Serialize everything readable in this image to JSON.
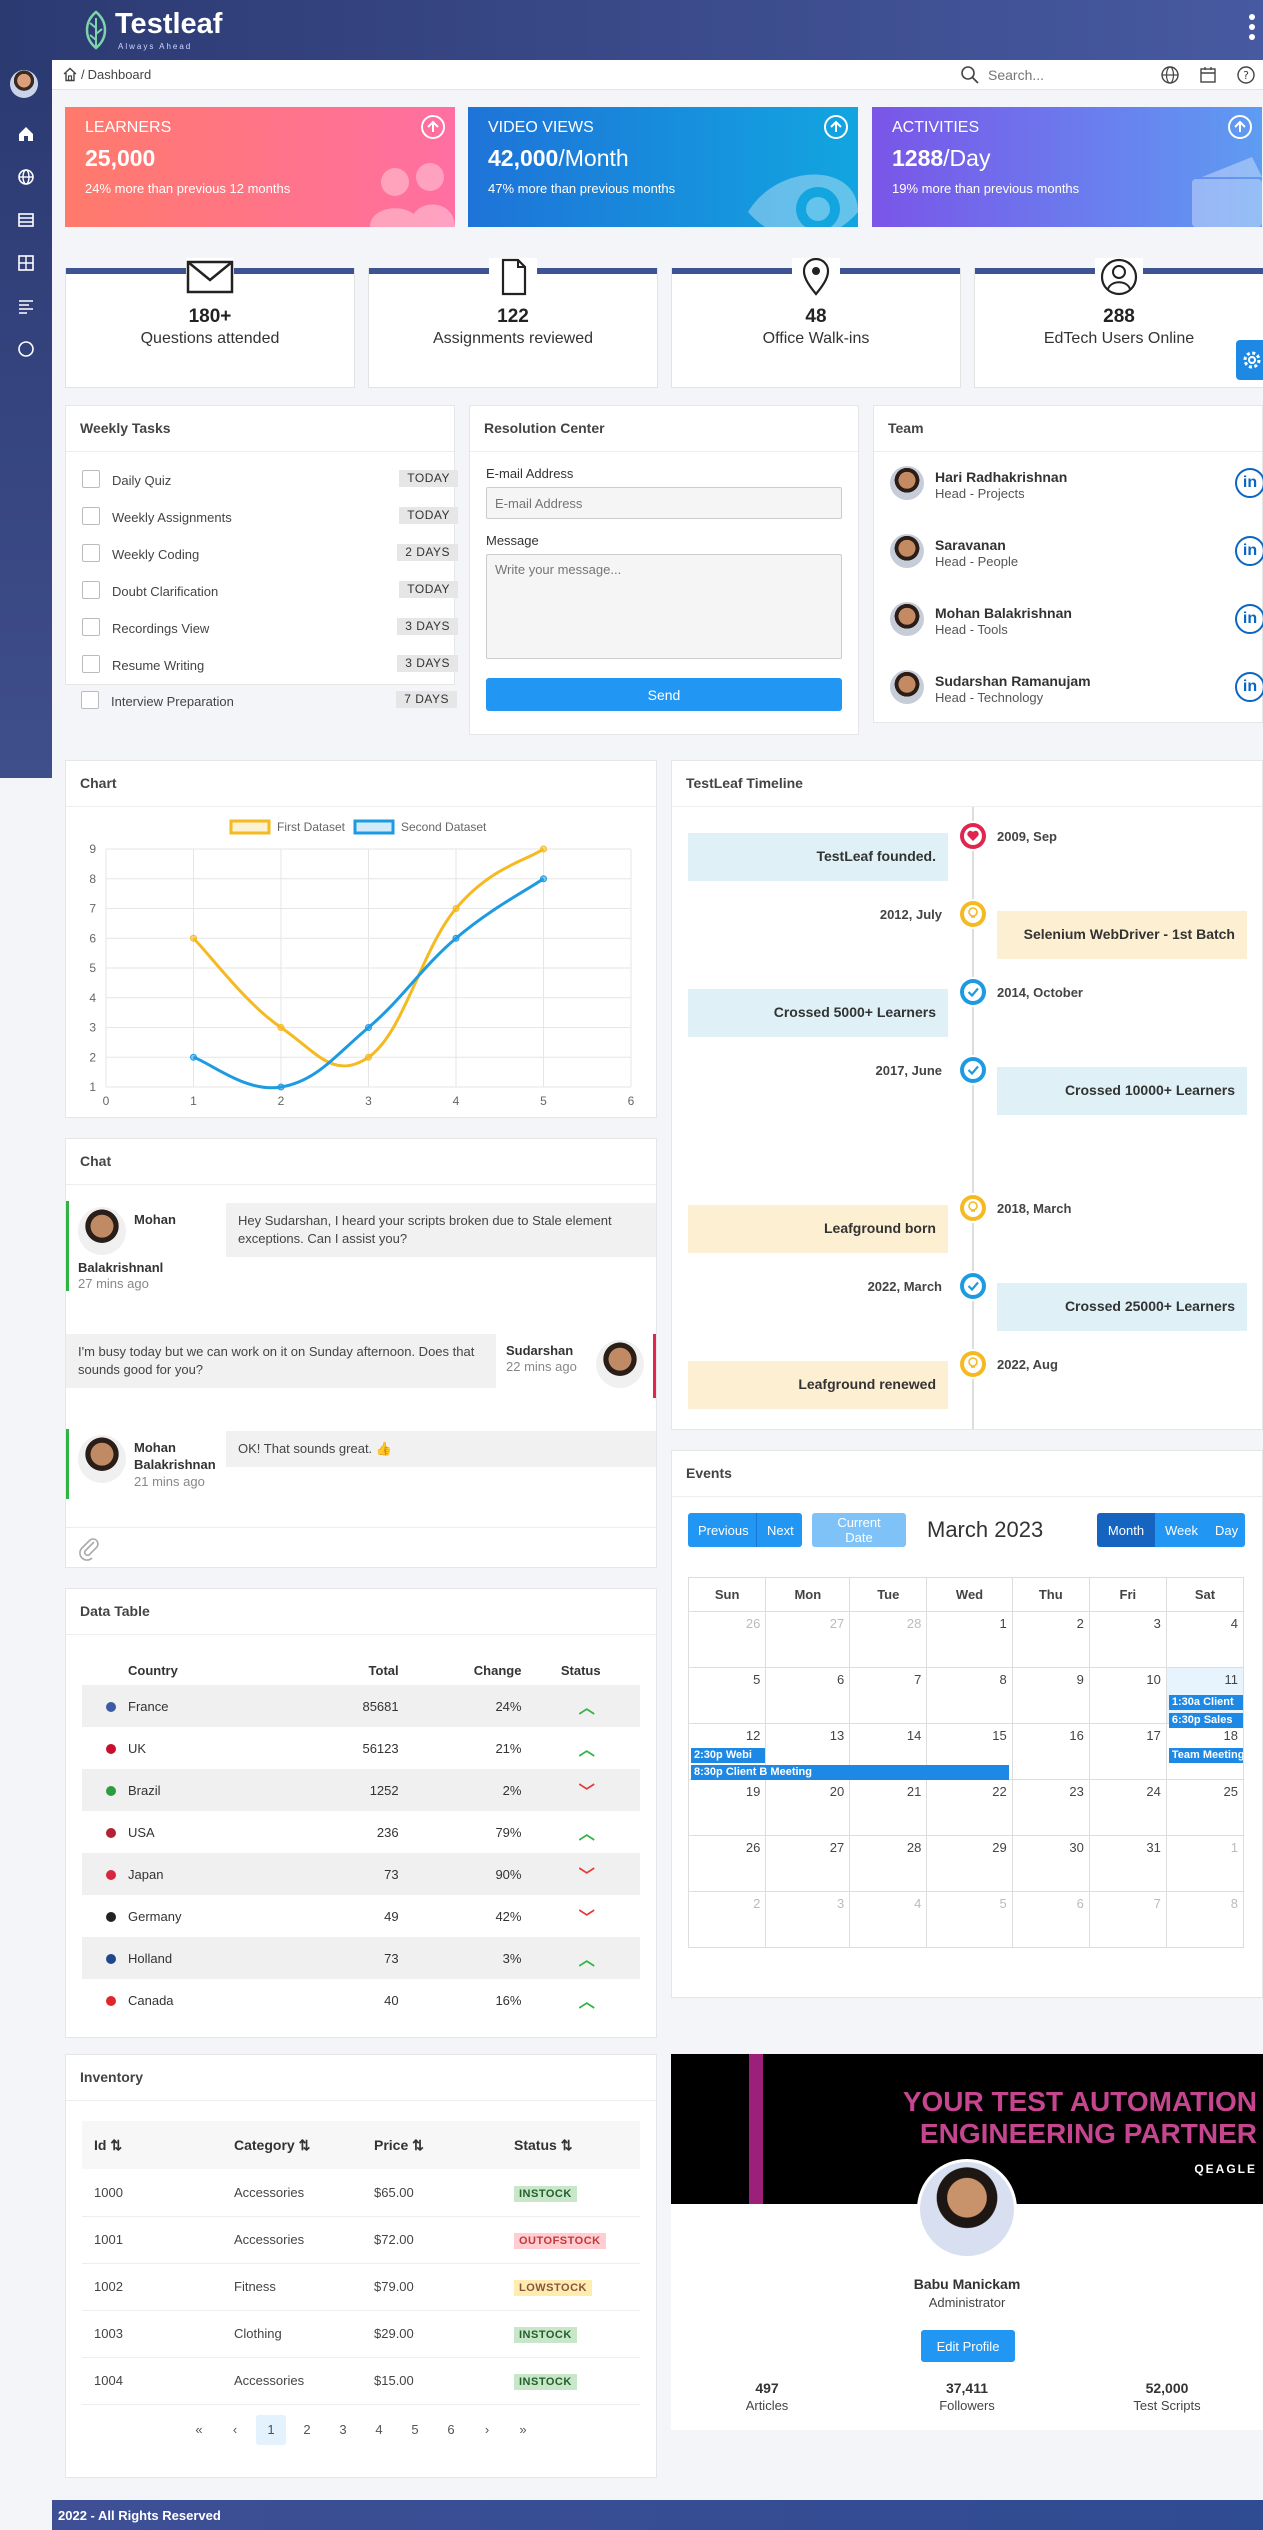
{
  "brand": {
    "name": "Testleaf",
    "tagline": "Always Ahead"
  },
  "breadcrumb": {
    "separator": "/",
    "current": "Dashboard"
  },
  "search": {
    "placeholder": "Search..."
  },
  "kpis": [
    {
      "label": "LEARNERS",
      "value": "25,000",
      "unit": "",
      "sub": "24% more than previous 12 months",
      "color_from": "#ff7a6b",
      "color_to": "#ff6fa2"
    },
    {
      "label": "VIDEO VIEWS",
      "value": "42,000",
      "unit": "/Month",
      "sub": "47% more than previous months",
      "color_from": "#1e73d8",
      "color_to": "#12a5e0"
    },
    {
      "label": "ACTIVITIES",
      "value": "1288",
      "unit": "/Day",
      "sub": "19% more than previous months",
      "color_from": "#7a55e8",
      "color_to": "#5e9cf2"
    }
  ],
  "stats": [
    {
      "number": "180+",
      "caption": "Questions attended",
      "icon": "envelope-icon"
    },
    {
      "number": "122",
      "caption": "Assignments reviewed",
      "icon": "document-icon"
    },
    {
      "number": "48",
      "caption": "Office Walk-ins",
      "icon": "location-pin-icon"
    },
    {
      "number": "288",
      "caption": "EdTech Users Online",
      "icon": "user-icon"
    }
  ],
  "weekly_tasks": {
    "title": "Weekly Tasks",
    "items": [
      {
        "label": "Daily Quiz",
        "badge": "TODAY"
      },
      {
        "label": "Weekly Assignments",
        "badge": "TODAY"
      },
      {
        "label": "Weekly Coding",
        "badge": "2 DAYS"
      },
      {
        "label": "Doubt Clarification",
        "badge": "TODAY"
      },
      {
        "label": "Recordings View",
        "badge": "3 DAYS"
      },
      {
        "label": "Resume Writing",
        "badge": "3 DAYS"
      },
      {
        "label": "Interview Preparation",
        "badge": "7 DAYS"
      }
    ]
  },
  "resolution": {
    "title": "Resolution Center",
    "email_label": "E-mail Address",
    "email_placeholder": "E-mail Address",
    "message_label": "Message",
    "message_placeholder": "Write your message...",
    "send_label": "Send"
  },
  "team": {
    "title": "Team",
    "members": [
      {
        "name": "Hari Radhakrishnan",
        "role": "Head - Projects"
      },
      {
        "name": "Saravanan",
        "role": "Head - People"
      },
      {
        "name": "Mohan Balakrishnan",
        "role": "Head - Tools"
      },
      {
        "name": "Sudarshan Ramanujam",
        "role": "Head - Technology"
      }
    ],
    "linkedin_glyph": "in"
  },
  "chart_card_title": "Chart",
  "chart_data": {
    "type": "line",
    "x": [
      1,
      2,
      3,
      4,
      5
    ],
    "series": [
      {
        "name": "First Dataset",
        "values": [
          6,
          3,
          2,
          7,
          9
        ],
        "color": "#f5b921"
      },
      {
        "name": "Second Dataset",
        "values": [
          2,
          1,
          3,
          6,
          8
        ],
        "color": "#1e9be0"
      }
    ],
    "xlim": [
      0,
      6
    ],
    "ylim": [
      1,
      9
    ],
    "xticks": [
      "0",
      "1",
      "2",
      "3",
      "4",
      "5",
      "6"
    ],
    "yticks": [
      "1",
      "2",
      "3",
      "4",
      "5",
      "6",
      "7",
      "8",
      "9"
    ],
    "grid": true,
    "legend": "top-center"
  },
  "timeline": {
    "title": "TestLeaf Timeline",
    "events": [
      {
        "text": "TestLeaf founded.",
        "date": "2009, Sep",
        "side": "left",
        "style": "blue",
        "dot": "heart",
        "dot_color": "#e0264f"
      },
      {
        "text": "Selenium WebDriver - 1st Batch",
        "date": "2012, July",
        "side": "right",
        "style": "yellow",
        "dot": "bulb",
        "dot_color": "#f5b921"
      },
      {
        "text": "Crossed 5000+ Learners",
        "date": "2014, October",
        "side": "left",
        "style": "blue",
        "dot": "check",
        "dot_color": "#1e9be0"
      },
      {
        "text": "Crossed 10000+ Learners",
        "date": "2017, June",
        "side": "right",
        "style": "blue",
        "dot": "check",
        "dot_color": "#1e9be0"
      },
      {
        "text": "Leafground born",
        "date": "2018, March",
        "side": "left",
        "style": "yellow",
        "dot": "bulb",
        "dot_color": "#f5b921"
      },
      {
        "text": "Crossed 25000+ Learners",
        "date": "2022, March",
        "side": "right",
        "style": "blue",
        "dot": "check",
        "dot_color": "#1e9be0"
      },
      {
        "text": "Leafground renewed",
        "date": "2022, Aug",
        "side": "left",
        "style": "yellow",
        "dot": "bulb",
        "dot_color": "#f5b921"
      }
    ]
  },
  "chat": {
    "title": "Chat",
    "messages": [
      {
        "first": "Mohan",
        "last": "Balakrishnanl",
        "time": "27 mins ago",
        "text": "Hey Sudarshan, I heard your scripts broken due to Stale element exceptions. Can I assist you?"
      },
      {
        "first": "Sudarshan",
        "last": "",
        "time": "22 mins ago",
        "text": "I'm busy today but we can work on it on Sunday afternoon. Does that sounds good for you?"
      },
      {
        "first": "Mohan",
        "last": "Balakrishnan",
        "time": "21 mins ago",
        "text": "OK! That sounds great. 👍"
      }
    ]
  },
  "datatable": {
    "title": "Data Table",
    "columns": [
      "Country",
      "Total",
      "Change",
      "Status"
    ],
    "rows": [
      {
        "country": "France",
        "total": "85681",
        "change": "24%",
        "status": "up",
        "flag": "#3b5ba7"
      },
      {
        "country": "UK",
        "total": "56123",
        "change": "21%",
        "status": "up",
        "flag": "#c8102e"
      },
      {
        "country": "Brazil",
        "total": "1252",
        "change": "2%",
        "status": "down",
        "flag": "#2e9b3e"
      },
      {
        "country": "USA",
        "total": "236",
        "change": "79%",
        "status": "up",
        "flag": "#b22234"
      },
      {
        "country": "Japan",
        "total": "73",
        "change": "90%",
        "status": "down",
        "flag": "#d7263d"
      },
      {
        "country": "Germany",
        "total": "49",
        "change": "42%",
        "status": "down",
        "flag": "#222222"
      },
      {
        "country": "Holland",
        "total": "73",
        "change": "3%",
        "status": "up",
        "flag": "#21468b"
      },
      {
        "country": "Canada",
        "total": "40",
        "change": "16%",
        "status": "up",
        "flag": "#e0262b"
      }
    ]
  },
  "events": {
    "title": "Events",
    "prev": "Previous",
    "next": "Next",
    "current": "Current Date",
    "month_title": "March 2023",
    "views": [
      "Month",
      "Week",
      "Day"
    ],
    "weekdays": [
      "Sun",
      "Mon",
      "Tue",
      "Wed",
      "Thu",
      "Fri",
      "Sat"
    ],
    "weeks": [
      [
        "26",
        "27",
        "28",
        "1",
        "2",
        "3",
        "4"
      ],
      [
        "5",
        "6",
        "7",
        "8",
        "9",
        "10",
        "11"
      ],
      [
        "12",
        "13",
        "14",
        "15",
        "16",
        "17",
        "18"
      ],
      [
        "19",
        "20",
        "21",
        "22",
        "23",
        "24",
        "25"
      ],
      [
        "26",
        "27",
        "28",
        "29",
        "30",
        "31",
        "1"
      ],
      [
        "2",
        "3",
        "4",
        "5",
        "6",
        "7",
        "8"
      ]
    ],
    "entries": [
      {
        "time": "1:30a",
        "title": "Client"
      },
      {
        "time": "6:30p",
        "title": "Sales"
      },
      {
        "time": "2:30p",
        "title": "Webi"
      },
      {
        "time": "8:30p",
        "title": "Client B Meeting"
      },
      {
        "time": "",
        "title": "Team Meeting"
      }
    ]
  },
  "inventory": {
    "title": "Inventory",
    "columns": [
      "Id",
      "Category",
      "Price",
      "Status"
    ],
    "rows": [
      {
        "id": "1000",
        "category": "Accessories",
        "price": "$65.00",
        "status": "INSTOCK"
      },
      {
        "id": "1001",
        "category": "Accessories",
        "price": "$72.00",
        "status": "OUTOFSTOCK"
      },
      {
        "id": "1002",
        "category": "Fitness",
        "price": "$79.00",
        "status": "LOWSTOCK"
      },
      {
        "id": "1003",
        "category": "Clothing",
        "price": "$29.00",
        "status": "INSTOCK"
      },
      {
        "id": "1004",
        "category": "Accessories",
        "price": "$15.00",
        "status": "INSTOCK"
      }
    ],
    "pages": [
      "1",
      "2",
      "3",
      "4",
      "5",
      "6"
    ],
    "current_page": "1"
  },
  "profile": {
    "banner_line1": "YOUR TEST AUTOMATION",
    "banner_line2": "ENGINEERING PARTNER",
    "banner_brand": "QEAGLE",
    "name": "Babu Manickam",
    "role": "Administrator",
    "edit_label": "Edit Profile",
    "stats": [
      {
        "value": "497",
        "label": "Articles"
      },
      {
        "value": "37,411",
        "label": "Followers"
      },
      {
        "value": "52,000",
        "label": "Test Scripts"
      }
    ]
  },
  "footer": {
    "text": "2022 - All Rights Reserved"
  }
}
